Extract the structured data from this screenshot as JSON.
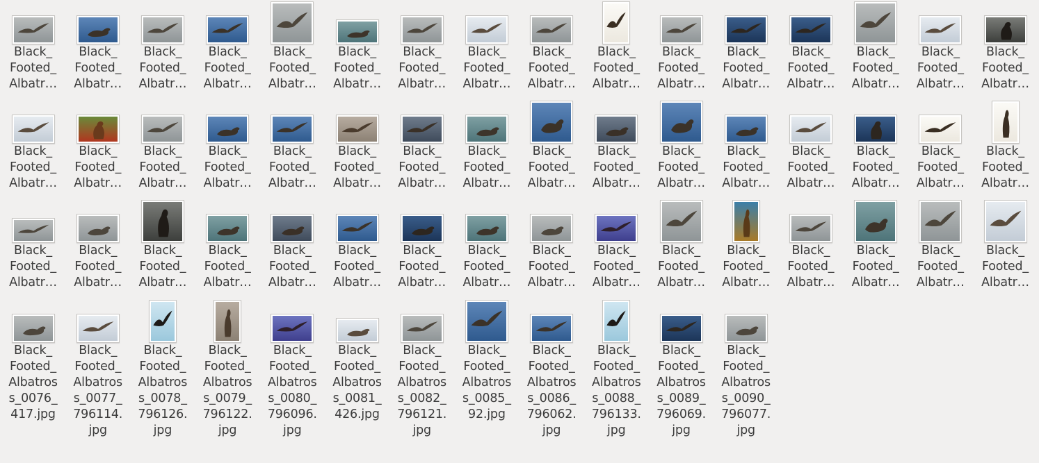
{
  "window": {
    "view": "file-manager-icon-grid"
  },
  "files": [
    {
      "name": "Black_Footed_Albatross_0001",
      "label_lines": [
        "Black_",
        "Footed_",
        "Albatr…"
      ],
      "palette": "gray",
      "pose": "flying",
      "shape": "landscape"
    },
    {
      "name": "Black_Footed_Albatross_0002",
      "label_lines": [
        "Black_",
        "Footed_",
        "Albatr…"
      ],
      "palette": "blue",
      "pose": "swimming",
      "shape": "landscape"
    },
    {
      "name": "Black_Footed_Albatross_0003",
      "label_lines": [
        "Black_",
        "Footed_",
        "Albatr…"
      ],
      "palette": "gray",
      "pose": "flying",
      "shape": "landscape"
    },
    {
      "name": "Black_Footed_Albatross_0004",
      "label_lines": [
        "Black_",
        "Footed_",
        "Albatr…"
      ],
      "palette": "blue",
      "pose": "flying",
      "shape": "landscape"
    },
    {
      "name": "Black_Footed_Albatross_0005",
      "label_lines": [
        "Black_",
        "Footed_",
        "Albatr…"
      ],
      "palette": "gray",
      "pose": "flying",
      "shape": "square"
    },
    {
      "name": "Black_Footed_Albatross_0006",
      "label_lines": [
        "Black_",
        "Footed_",
        "Albatr…"
      ],
      "palette": "sea",
      "pose": "swimming",
      "shape": "wide"
    },
    {
      "name": "Black_Footed_Albatross_0007",
      "label_lines": [
        "Black_",
        "Footed_",
        "Albatr…"
      ],
      "palette": "gray",
      "pose": "flying",
      "shape": "landscape"
    },
    {
      "name": "Black_Footed_Albatross_0008",
      "label_lines": [
        "Black_",
        "Footed_",
        "Albatr…"
      ],
      "palette": "pale",
      "pose": "flying",
      "shape": "landscape"
    },
    {
      "name": "Black_Footed_Albatross_0009",
      "label_lines": [
        "Black_",
        "Footed_",
        "Albatr…"
      ],
      "palette": "gray",
      "pose": "flying",
      "shape": "landscape"
    },
    {
      "name": "Black_Footed_Albatross_0010",
      "label_lines": [
        "Black_",
        "Footed_",
        "Albatr…"
      ],
      "palette": "white",
      "pose": "flying",
      "shape": "portrait"
    },
    {
      "name": "Black_Footed_Albatross_0011",
      "label_lines": [
        "Black_",
        "Footed_",
        "Albatr…"
      ],
      "palette": "gray",
      "pose": "flying",
      "shape": "landscape"
    },
    {
      "name": "Black_Footed_Albatross_0012",
      "label_lines": [
        "Black_",
        "Footed_",
        "Albatr…"
      ],
      "palette": "navy",
      "pose": "flying",
      "shape": "landscape"
    },
    {
      "name": "Black_Footed_Albatross_0013",
      "label_lines": [
        "Black_",
        "Footed_",
        "Albatr…"
      ],
      "palette": "navy",
      "pose": "flying",
      "shape": "landscape"
    },
    {
      "name": "Black_Footed_Albatross_0014",
      "label_lines": [
        "Black_",
        "Footed_",
        "Albatr…"
      ],
      "palette": "gray",
      "pose": "flying",
      "shape": "square"
    },
    {
      "name": "Black_Footed_Albatross_0015",
      "label_lines": [
        "Black_",
        "Footed_",
        "Albatr…"
      ],
      "palette": "pale",
      "pose": "flying",
      "shape": "landscape"
    },
    {
      "name": "Black_Footed_Albatross_0016",
      "label_lines": [
        "Black_",
        "Footed_",
        "Albatr…"
      ],
      "palette": "dark",
      "pose": "standing",
      "shape": "landscape"
    },
    {
      "name": "Black_Footed_Albatross_0017",
      "label_lines": [
        "Black_",
        "Footed_",
        "Albatr…"
      ],
      "palette": "pale",
      "pose": "flying",
      "shape": "landscape"
    },
    {
      "name": "Black_Footed_Albatross_0018",
      "label_lines": [
        "Black_",
        "Footed_",
        "Albatr…"
      ],
      "palette": "green",
      "pose": "standing",
      "shape": "landscape"
    },
    {
      "name": "Black_Footed_Albatross_0019",
      "label_lines": [
        "Black_",
        "Footed_",
        "Albatr…"
      ],
      "palette": "gray",
      "pose": "flying",
      "shape": "landscape"
    },
    {
      "name": "Black_Footed_Albatross_0020",
      "label_lines": [
        "Black_",
        "Footed_",
        "Albatr…"
      ],
      "palette": "blue",
      "pose": "swimming",
      "shape": "landscape"
    },
    {
      "name": "Black_Footed_Albatross_0021",
      "label_lines": [
        "Black_",
        "Footed_",
        "Albatr…"
      ],
      "palette": "blue",
      "pose": "flying",
      "shape": "landscape"
    },
    {
      "name": "Black_Footed_Albatross_0022",
      "label_lines": [
        "Black_",
        "Footed_",
        "Albatr…"
      ],
      "palette": "tan",
      "pose": "flying",
      "shape": "landscape"
    },
    {
      "name": "Black_Footed_Albatross_0023",
      "label_lines": [
        "Black_",
        "Footed_",
        "Albatr…"
      ],
      "palette": "slate",
      "pose": "flying",
      "shape": "landscape"
    },
    {
      "name": "Black_Footed_Albatross_0024",
      "label_lines": [
        "Black_",
        "Footed_",
        "Albatr…"
      ],
      "palette": "sea",
      "pose": "swimming",
      "shape": "landscape"
    },
    {
      "name": "Black_Footed_Albatross_0025",
      "label_lines": [
        "Black_",
        "Footed_",
        "Albatr…"
      ],
      "palette": "blue",
      "pose": "swimming",
      "shape": "square"
    },
    {
      "name": "Black_Footed_Albatross_0026",
      "label_lines": [
        "Black_",
        "Footed_",
        "Albatr…"
      ],
      "palette": "slate",
      "pose": "swimming",
      "shape": "landscape"
    },
    {
      "name": "Black_Footed_Albatross_0027",
      "label_lines": [
        "Black_",
        "Footed_",
        "Albatr…"
      ],
      "palette": "blue",
      "pose": "swimming",
      "shape": "square"
    },
    {
      "name": "Black_Footed_Albatross_0028",
      "label_lines": [
        "Black_",
        "Footed_",
        "Albatr…"
      ],
      "palette": "blue",
      "pose": "swimming",
      "shape": "landscape"
    },
    {
      "name": "Black_Footed_Albatross_0029",
      "label_lines": [
        "Black_",
        "Footed_",
        "Albatr…"
      ],
      "palette": "pale",
      "pose": "flying",
      "shape": "landscape"
    },
    {
      "name": "Black_Footed_Albatross_0030",
      "label_lines": [
        "Black_",
        "Footed_",
        "Albatr…"
      ],
      "palette": "navy",
      "pose": "standing",
      "shape": "landscape"
    },
    {
      "name": "Black_Footed_Albatross_0031",
      "label_lines": [
        "Black_",
        "Footed_",
        "Albatr…"
      ],
      "palette": "white",
      "pose": "flying",
      "shape": "landscape"
    },
    {
      "name": "Black_Footed_Albatross_0032",
      "label_lines": [
        "Black_",
        "Footed_",
        "Albatr…"
      ],
      "palette": "white",
      "pose": "standing",
      "shape": "portrait"
    },
    {
      "name": "Black_Footed_Albatross_0033",
      "label_lines": [
        "Black_",
        "Footed_",
        "Albatr…"
      ],
      "palette": "gray",
      "pose": "flying",
      "shape": "wide"
    },
    {
      "name": "Black_Footed_Albatross_0034",
      "label_lines": [
        "Black_",
        "Footed_",
        "Albatr…"
      ],
      "palette": "gray",
      "pose": "swimming",
      "shape": "landscape"
    },
    {
      "name": "Black_Footed_Albatross_0035",
      "label_lines": [
        "Black_",
        "Footed_",
        "Albatr…"
      ],
      "palette": "dark",
      "pose": "standing",
      "shape": "square"
    },
    {
      "name": "Black_Footed_Albatross_0036",
      "label_lines": [
        "Black_",
        "Footed_",
        "Albatr…"
      ],
      "palette": "sea",
      "pose": "swimming",
      "shape": "landscape"
    },
    {
      "name": "Black_Footed_Albatross_0037",
      "label_lines": [
        "Black_",
        "Footed_",
        "Albatr…"
      ],
      "palette": "slate",
      "pose": "swimming",
      "shape": "landscape"
    },
    {
      "name": "Black_Footed_Albatross_0038",
      "label_lines": [
        "Black_",
        "Footed_",
        "Albatr…"
      ],
      "palette": "blue",
      "pose": "flying",
      "shape": "landscape"
    },
    {
      "name": "Black_Footed_Albatross_0039",
      "label_lines": [
        "Black_",
        "Footed_",
        "Albatr…"
      ],
      "palette": "navy",
      "pose": "swimming",
      "shape": "landscape"
    },
    {
      "name": "Black_Footed_Albatross_0040",
      "label_lines": [
        "Black_",
        "Footed_",
        "Albatr…"
      ],
      "palette": "sea",
      "pose": "swimming",
      "shape": "landscape"
    },
    {
      "name": "Black_Footed_Albatross_0041",
      "label_lines": [
        "Black_",
        "Footed_",
        "Albatr…"
      ],
      "palette": "gray",
      "pose": "swimming",
      "shape": "landscape"
    },
    {
      "name": "Black_Footed_Albatross_0042",
      "label_lines": [
        "Black_",
        "Footed_",
        "Albatr…"
      ],
      "palette": "violet",
      "pose": "flying",
      "shape": "landscape"
    },
    {
      "name": "Black_Footed_Albatross_0043",
      "label_lines": [
        "Black_",
        "Footed_",
        "Albatr…"
      ],
      "palette": "gray",
      "pose": "flying",
      "shape": "square"
    },
    {
      "name": "Black_Footed_Albatross_0044",
      "label_lines": [
        "Black_",
        "Footed_",
        "Albatr…"
      ],
      "palette": "olive",
      "pose": "standing",
      "shape": "portrait"
    },
    {
      "name": "Black_Footed_Albatross_0045",
      "label_lines": [
        "Black_",
        "Footed_",
        "Albatr…"
      ],
      "palette": "gray",
      "pose": "flying",
      "shape": "landscape"
    },
    {
      "name": "Black_Footed_Albatross_0046",
      "label_lines": [
        "Black_",
        "Footed_",
        "Albatr…"
      ],
      "palette": "sea",
      "pose": "swimming",
      "shape": "square"
    },
    {
      "name": "Black_Footed_Albatross_0047",
      "label_lines": [
        "Black_",
        "Footed_",
        "Albatr…"
      ],
      "palette": "gray",
      "pose": "flying",
      "shape": "square"
    },
    {
      "name": "Black_Footed_Albatross_0048",
      "label_lines": [
        "Black_",
        "Footed_",
        "Albatr…"
      ],
      "palette": "pale",
      "pose": "flying",
      "shape": "square"
    },
    {
      "name": "Black_Footed_Albatross_0076_417.jpg",
      "label_lines": [
        "Black_",
        "Footed_",
        "Albatros",
        "s_0076_",
        "417.jpg"
      ],
      "palette": "gray",
      "pose": "swimming",
      "shape": "landscape"
    },
    {
      "name": "Black_Footed_Albatross_0077_796114.jpg",
      "label_lines": [
        "Black_",
        "Footed_",
        "Albatros",
        "s_0077_",
        "796114.",
        "jpg"
      ],
      "palette": "pale",
      "pose": "flying",
      "shape": "landscape"
    },
    {
      "name": "Black_Footed_Albatross_0078_796126.jpg",
      "label_lines": [
        "Black_",
        "Footed_",
        "Albatros",
        "s_0078_",
        "796126.",
        "jpg"
      ],
      "palette": "sky",
      "pose": "flying",
      "shape": "portrait"
    },
    {
      "name": "Black_Footed_Albatross_0079_796122.jpg",
      "label_lines": [
        "Black_",
        "Footed_",
        "Albatros",
        "s_0079_",
        "796122.",
        "jpg"
      ],
      "palette": "tan",
      "pose": "standing",
      "shape": "portrait"
    },
    {
      "name": "Black_Footed_Albatross_0080_796096.jpg",
      "label_lines": [
        "Black_",
        "Footed_",
        "Albatros",
        "s_0080_",
        "796096.",
        "jpg"
      ],
      "palette": "violet",
      "pose": "flying",
      "shape": "landscape"
    },
    {
      "name": "Black_Footed_Albatross_0081_426.jpg",
      "label_lines": [
        "Black_",
        "Footed_",
        "Albatros",
        "s_0081_",
        "426.jpg"
      ],
      "palette": "pale",
      "pose": "swimming",
      "shape": "wide"
    },
    {
      "name": "Black_Footed_Albatross_0082_796121.jpg",
      "label_lines": [
        "Black_",
        "Footed_",
        "Albatros",
        "s_0082_",
        "796121.",
        "jpg"
      ],
      "palette": "gray",
      "pose": "flying",
      "shape": "landscape"
    },
    {
      "name": "Black_Footed_Albatross_0085_92.jpg",
      "label_lines": [
        "Black_",
        "Footed_",
        "Albatros",
        "s_0085_",
        "92.jpg"
      ],
      "palette": "blue",
      "pose": "flying",
      "shape": "square"
    },
    {
      "name": "Black_Footed_Albatross_0086_796062.jpg",
      "label_lines": [
        "Black_",
        "Footed_",
        "Albatros",
        "s_0086_",
        "796062.",
        "jpg"
      ],
      "palette": "blue",
      "pose": "flying",
      "shape": "landscape"
    },
    {
      "name": "Black_Footed_Albatross_0088_796133.jpg",
      "label_lines": [
        "Black_",
        "Footed_",
        "Albatros",
        "s_0088_",
        "796133.",
        "jpg"
      ],
      "palette": "sky",
      "pose": "flying",
      "shape": "portrait"
    },
    {
      "name": "Black_Footed_Albatross_0089_796069.jpg",
      "label_lines": [
        "Black_",
        "Footed_",
        "Albatros",
        "s_0089_",
        "796069.",
        "jpg"
      ],
      "palette": "navy",
      "pose": "flying",
      "shape": "landscape"
    },
    {
      "name": "Black_Footed_Albatross_0090_796077.jpg",
      "label_lines": [
        "Black_",
        "Footed_",
        "Albatros",
        "s_0090_",
        "796077.",
        "jpg"
      ],
      "palette": "gray",
      "pose": "swimming",
      "shape": "landscape"
    }
  ],
  "colors": {
    "background": "#f1f0ef",
    "label_text": "#3c3c3c",
    "thumb_border": "#c7c5c2"
  },
  "palettes": {
    "gray": {
      "bg1": "#b9bcbc",
      "bg2": "#8f9597",
      "bird": "#4d463c"
    },
    "blue": {
      "bg1": "#5d86b8",
      "bg2": "#2f5a8e",
      "bird": "#3b3228"
    },
    "sea": {
      "bg1": "#7fa0a3",
      "bg2": "#4e7479",
      "bird": "#3d342a"
    },
    "pale": {
      "bg1": "#e6ebf0",
      "bg2": "#c3ccd6",
      "bird": "#5a4c3e"
    },
    "white": {
      "bg1": "#fbfaf6",
      "bg2": "#ece8df",
      "bird": "#3a2e22"
    },
    "navy": {
      "bg1": "#3a5d8a",
      "bg2": "#1c3558",
      "bird": "#2d261f"
    },
    "dark": {
      "bg1": "#7a7c78",
      "bg2": "#3d3f3c",
      "bird": "#1f1b17"
    },
    "green": {
      "bg1": "#6a8a3a",
      "bg2": "#b0361f",
      "bird": "#6a3a1c"
    },
    "tan": {
      "bg1": "#b7aca0",
      "bg2": "#8c8174",
      "bird": "#4a3b2d"
    },
    "slate": {
      "bg1": "#6f7c8c",
      "bg2": "#3f4b5b",
      "bird": "#3a3027"
    },
    "violet": {
      "bg1": "#6d74c0",
      "bg2": "#3f3f8d",
      "bird": "#2e1f2a"
    },
    "olive": {
      "bg1": "#3c7fa8",
      "bg2": "#a87a28",
      "bird": "#5a3a18"
    },
    "sky": {
      "bg1": "#cfe6f1",
      "bg2": "#9bc8dc",
      "bird": "#1d1a17"
    }
  }
}
